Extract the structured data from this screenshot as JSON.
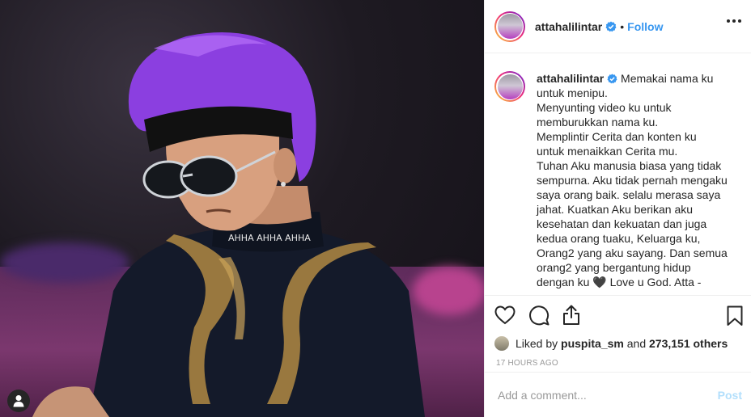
{
  "post": {
    "username": "attahalilintar",
    "follow_label": "Follow",
    "separator": "•",
    "caption_lines": [
      "Memakai nama ku",
      "untuk menipu.",
      "Menyunting video ku untuk",
      "memburukkan nama ku.",
      "Memplintir Cerita dan konten ku",
      "untuk menaikkan Cerita mu.",
      "Tuhan Aku manusia biasa yang tidak",
      "sempurna. Aku tidak pernah mengaku",
      "saya orang baik. selalu merasa saya",
      "jahat. Kuatkan Aku berikan aku",
      "kesehatan dan kekuatan dan juga",
      "kedua orang tuaku, Keluarga ku,",
      "Orang2 yang aku sayang. Dan semua",
      "orang2 yang bergantung hidup",
      "dengan ku 🖤 Love u God. Atta -"
    ],
    "liked_by_prefix": "Liked by",
    "liked_by_user": "puspita_sm",
    "liked_by_and": "and",
    "liked_count": "273,151 others",
    "timestamp": "17 HOURS AGO",
    "comment_placeholder": "Add a comment...",
    "post_label": "Post"
  },
  "icons": {
    "verified": "verified-badge-icon",
    "more": "more-options-icon",
    "like": "heart-icon",
    "comment": "comment-icon",
    "share": "share-icon",
    "save": "bookmark-icon",
    "user": "user-tag-icon"
  },
  "colors": {
    "accent": "#3897f0",
    "text": "#262626",
    "muted": "#999999",
    "post_disabled": "#b2dffc",
    "hair": "#8b3fe0"
  },
  "photo": {
    "shirt_text": "AHHA AHHA AHHA"
  }
}
